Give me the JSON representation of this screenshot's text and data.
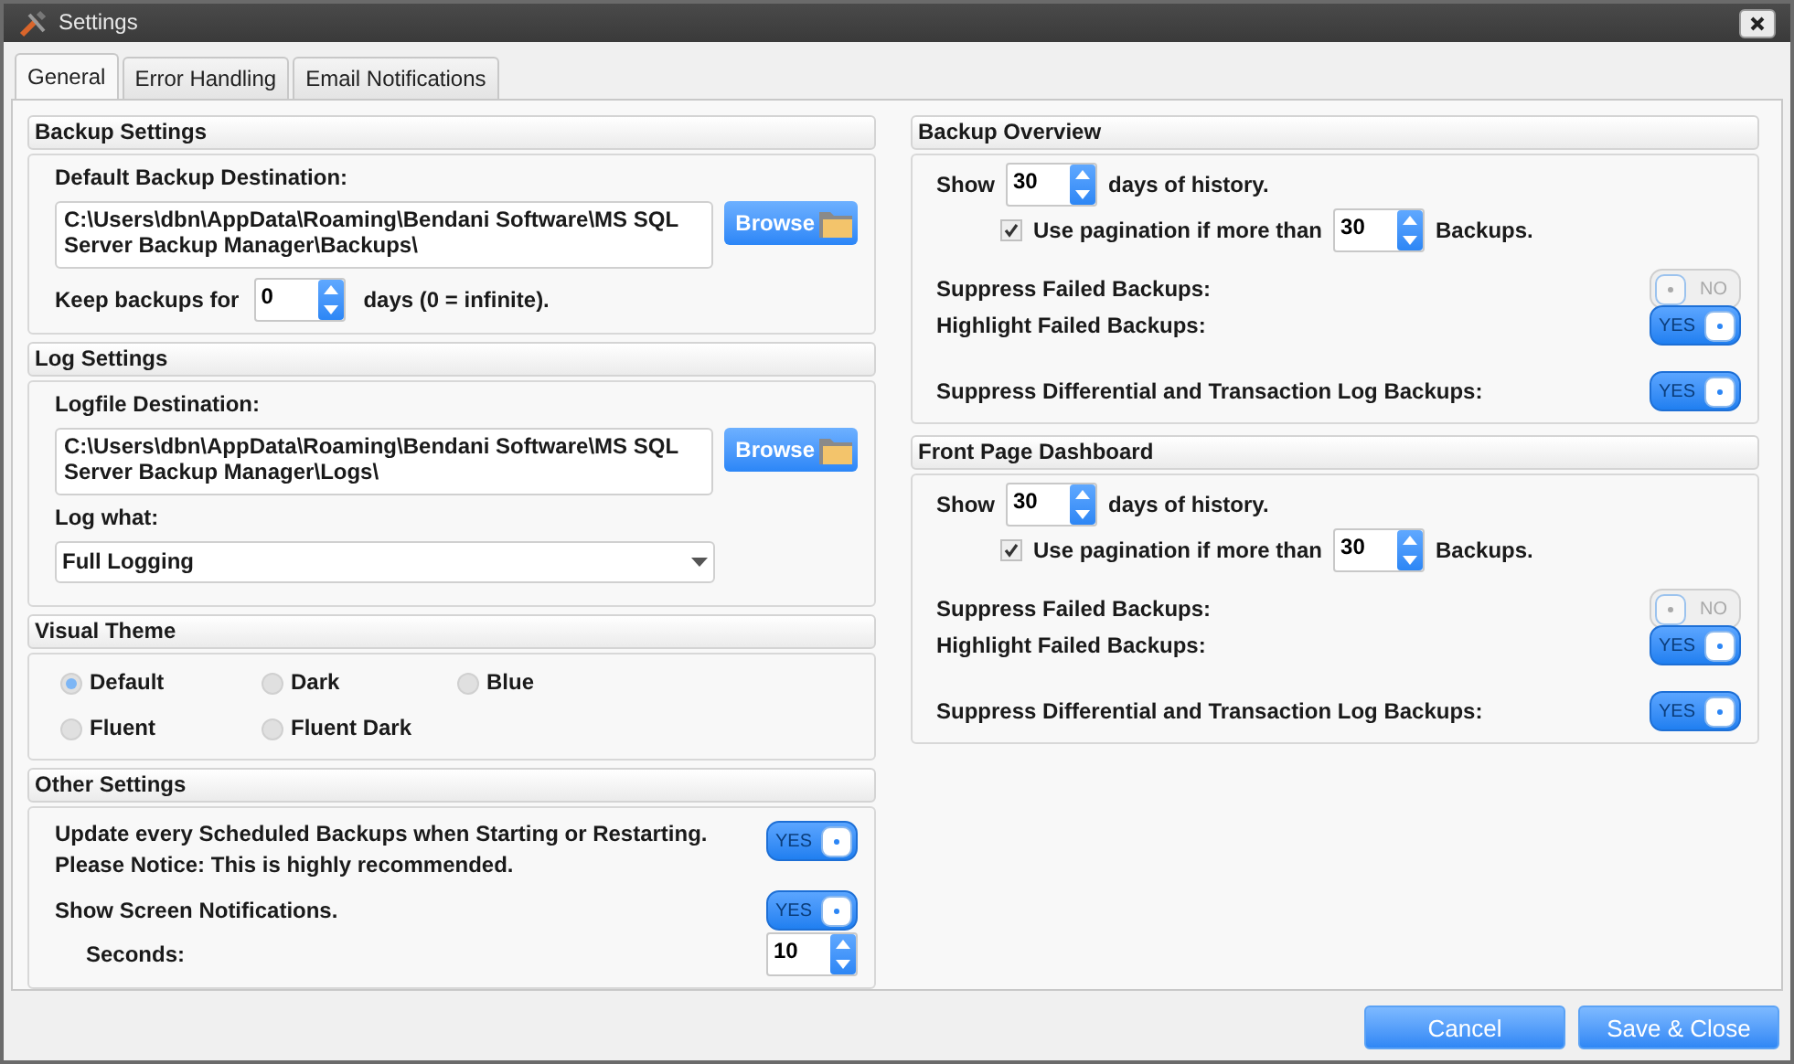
{
  "window": {
    "title": "Settings"
  },
  "tabs": [
    {
      "label": "General",
      "selected": true
    },
    {
      "label": "Error Handling",
      "selected": false
    },
    {
      "label": "Email Notifications",
      "selected": false
    }
  ],
  "backup_settings": {
    "title": "Backup Settings",
    "destination_label": "Default Backup Destination:",
    "destination": "C:\\Users\\dbn\\AppData\\Roaming\\Bendani Software\\MS SQL Server Backup Manager\\Backups\\",
    "browse": "Browse",
    "keep_label": "Keep backups for",
    "keep_value": "0",
    "keep_suffix": "days  (0 = infinite)."
  },
  "log_settings": {
    "title": "Log Settings",
    "destination_label": "Logfile Destination:",
    "destination": "C:\\Users\\dbn\\AppData\\Roaming\\Bendani Software\\MS SQL Server Backup Manager\\Logs\\",
    "browse": "Browse",
    "log_what_label": "Log what:",
    "log_what": "Full Logging"
  },
  "visual_theme": {
    "title": "Visual Theme",
    "options": [
      {
        "label": "Default",
        "selected": true
      },
      {
        "label": "Dark",
        "selected": false
      },
      {
        "label": "Blue",
        "selected": false
      },
      {
        "label": "Fluent",
        "selected": false
      },
      {
        "label": "Fluent Dark",
        "selected": false
      }
    ]
  },
  "other_settings": {
    "title": "Other Settings",
    "update_text": "Update every Scheduled Backups when Starting or Restarting.",
    "update_notice": "Please Notice: This is highly recommended.",
    "update_toggle": {
      "on": true,
      "label": "YES"
    },
    "notifications_label": "Show Screen Notifications.",
    "notifications_toggle": {
      "on": true,
      "label": "YES"
    },
    "seconds_label": "Seconds:",
    "seconds_value": "10"
  },
  "right_sections": [
    {
      "title": "Backup Overview",
      "show_label": "Show",
      "days_value": "30",
      "days_suffix": "days of history.",
      "pagination_label": "Use pagination if more than",
      "pagination_checked": true,
      "pagination_value": "30",
      "pagination_suffix": "Backups.",
      "rows": [
        {
          "label": "Suppress Failed Backups:",
          "on": false,
          "toggle_label": "NO"
        },
        {
          "label": "Highlight Failed Backups:",
          "on": true,
          "toggle_label": "YES"
        },
        {
          "label": "Suppress Differential and Transaction Log Backups:",
          "on": true,
          "toggle_label": "YES"
        }
      ]
    },
    {
      "title": "Front Page Dashboard",
      "show_label": "Show",
      "days_value": "30",
      "days_suffix": "days of history.",
      "pagination_label": "Use pagination if more than",
      "pagination_checked": true,
      "pagination_value": "30",
      "pagination_suffix": "Backups.",
      "rows": [
        {
          "label": "Suppress Failed Backups:",
          "on": false,
          "toggle_label": "NO"
        },
        {
          "label": "Highlight Failed Backups:",
          "on": true,
          "toggle_label": "YES"
        },
        {
          "label": "Suppress Differential and Transaction Log Backups:",
          "on": true,
          "toggle_label": "YES"
        }
      ]
    }
  ],
  "buttons": [
    "Cancel",
    "Save & Close"
  ]
}
